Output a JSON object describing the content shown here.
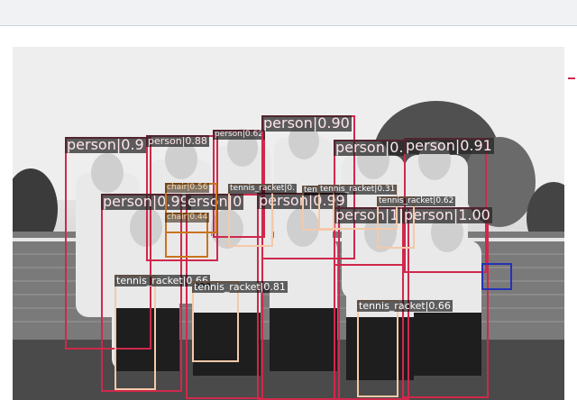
{
  "colors": {
    "person": "#d0284c",
    "tennis_racket": "#f4c9a8",
    "chair": "#c9741e",
    "other": "#2532b8"
  },
  "detections": [
    {
      "id": "p1",
      "text": "person|0.9",
      "cls": "person",
      "size": "lg"
    },
    {
      "id": "p2",
      "text": "person|0.88",
      "cls": "person",
      "size": "sm"
    },
    {
      "id": "p3",
      "text": "person|0.62",
      "cls": "person",
      "size": "xs"
    },
    {
      "id": "p4",
      "text": "person|0.90",
      "cls": "person",
      "size": "lg"
    },
    {
      "id": "p5",
      "text": "person|0.",
      "cls": "person",
      "size": "lg"
    },
    {
      "id": "p6",
      "text": "person|0.91",
      "cls": "person",
      "size": "lg"
    },
    {
      "id": "p7",
      "text": "person|0.99",
      "cls": "person",
      "size": "lg"
    },
    {
      "id": "p8",
      "text": "erson|0",
      "cls": "person",
      "size": "lg"
    },
    {
      "id": "p9",
      "text": "person|0.99",
      "cls": "person",
      "size": "lg"
    },
    {
      "id": "p10",
      "text": "person|1",
      "cls": "person",
      "size": "lg"
    },
    {
      "id": "p11",
      "text": "person|1.00",
      "cls": "person",
      "size": "lg"
    },
    {
      "id": "c1",
      "text": "chair|0.56",
      "cls": "chair",
      "size": "xs"
    },
    {
      "id": "c2",
      "text": "chair|0.44",
      "cls": "chair",
      "size": "xs"
    },
    {
      "id": "r1",
      "text": "tennis_racket|0.",
      "cls": "tennis_racket",
      "size": "xs"
    },
    {
      "id": "r2",
      "text": "ten",
      "cls": "tennis_racket",
      "size": "xs"
    },
    {
      "id": "r3",
      "text": "tennis_racket|0.31",
      "cls": "tennis_racket",
      "size": "xs"
    },
    {
      "id": "r4",
      "text": "tennis_racket|0.62",
      "cls": "tennis_racket",
      "size": "xs"
    },
    {
      "id": "r5",
      "text": "tennis_racket|0.66",
      "cls": "tennis_racket",
      "size": "sm"
    },
    {
      "id": "r6",
      "text": "tennis_racket|0.81",
      "cls": "tennis_racket",
      "size": "sm"
    },
    {
      "id": "r7",
      "text": "tennis_racket|0.66",
      "cls": "tennis_racket",
      "size": "sm"
    },
    {
      "id": "o1",
      "text": "",
      "cls": "other",
      "size": "xs"
    }
  ]
}
